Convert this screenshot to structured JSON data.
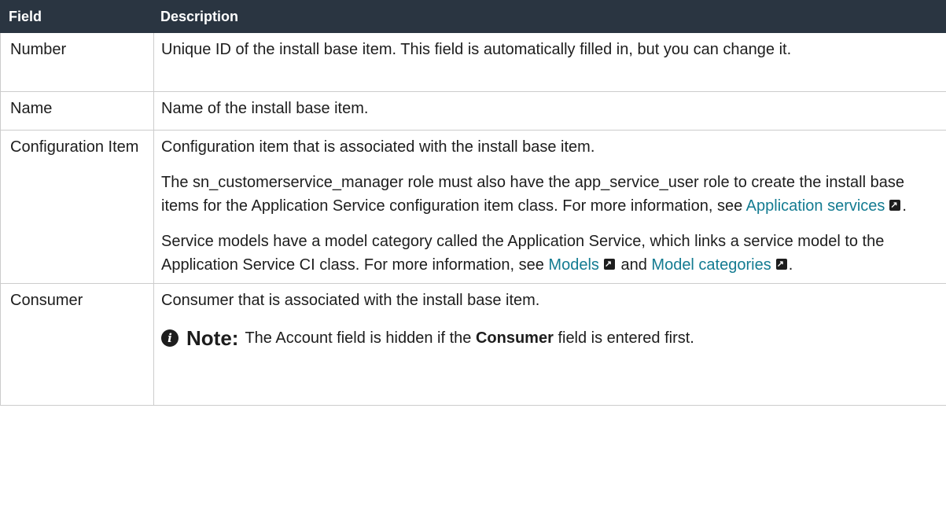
{
  "table": {
    "headers": {
      "field": "Field",
      "description": "Description"
    },
    "rows": [
      {
        "field": "Number",
        "description": "Unique ID of the install base item. This field is automatically filled in, but you can change it."
      },
      {
        "field": "Name",
        "description": "Name of the install base item."
      },
      {
        "field": "Configuration Item",
        "p1": "Configuration item that is associated with the install base item.",
        "p2_text": "The sn_customerservice_manager role must also have the app_service_user role to create the install base items for the Application Service configuration item class. For more information, see ",
        "p2_link": "Application services",
        "p2_end": ".",
        "p3_text": "Service models have a model category called the Application Service, which links a service model to the Application Service CI class. For more information, see ",
        "p3_link1": "Models",
        "p3_mid": "and",
        "p3_link2": "Model categories",
        "p3_end": "."
      },
      {
        "field": "Consumer",
        "p1": "Consumer that is associated with the install base item.",
        "note_label": "Note:",
        "note_pre": "The Account field is hidden if the",
        "note_bold": "Consumer",
        "note_post": "field is entered first."
      }
    ]
  },
  "icons": {
    "external_link": "external-link-icon",
    "info": "info-icon"
  },
  "colors": {
    "header_bg": "#2a3541",
    "link": "#137b91",
    "border": "#cccccc"
  }
}
